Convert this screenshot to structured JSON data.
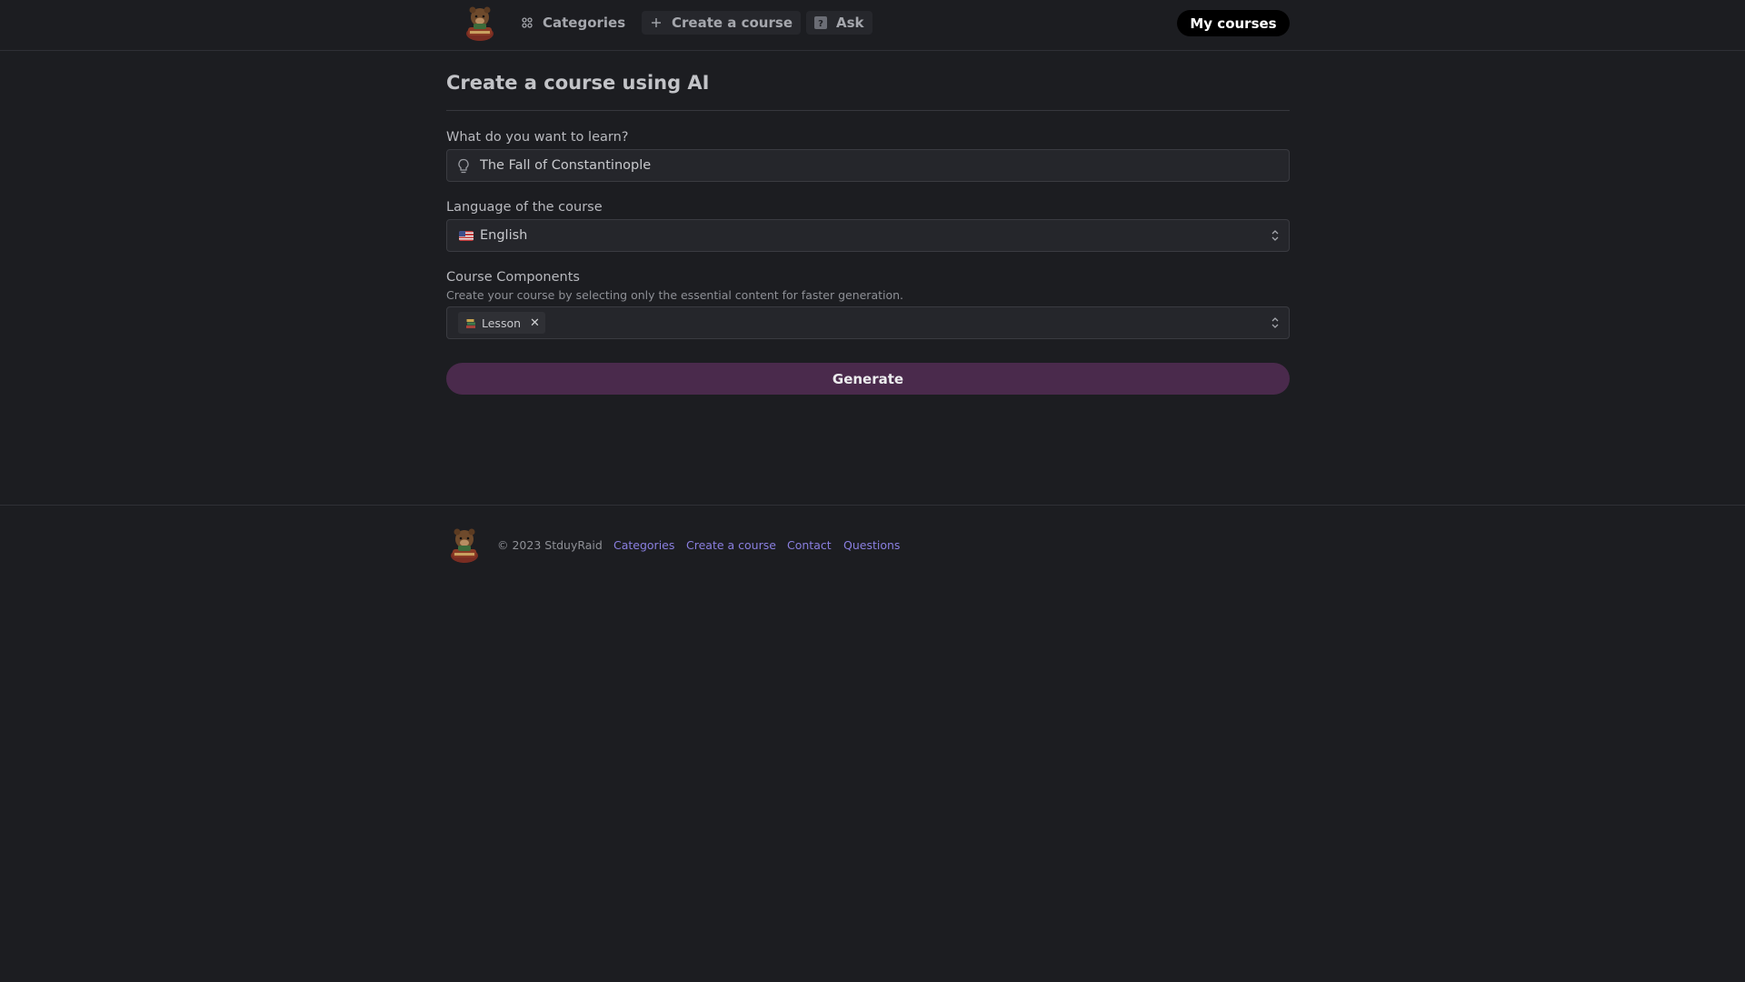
{
  "header": {
    "nav": {
      "categories": "Categories",
      "create": "Create a course",
      "ask": "Ask"
    },
    "my_courses": "My courses"
  },
  "page": {
    "title": "Create a course using AI"
  },
  "form": {
    "topic_label": "What do you want to learn?",
    "topic_value": "The Fall of Constantinople",
    "language_label": "Language of the course",
    "language_value": "English",
    "components_label": "Course Components",
    "components_help": "Create your course by selecting only the essential content for faster generation.",
    "components_tags": [
      "Lesson"
    ],
    "generate": "Generate"
  },
  "footer": {
    "copyright": "© 2023 StduyRaid",
    "links": [
      "Categories",
      "Create a course",
      "Contact",
      "Questions"
    ]
  },
  "icons": {
    "nav_categories": "grid-icon",
    "nav_create": "plus-icon",
    "nav_ask": "question-icon",
    "topic": "lightbulb-icon",
    "language": "us-flag-icon",
    "select": "chevron-updown-icon",
    "tag": "books-icon",
    "remove": "close-icon"
  },
  "colors": {
    "background": "#1c1d21",
    "generate_button": "#4a2a4c",
    "link": "#8a7fe0",
    "my_courses_button": "#000000"
  }
}
